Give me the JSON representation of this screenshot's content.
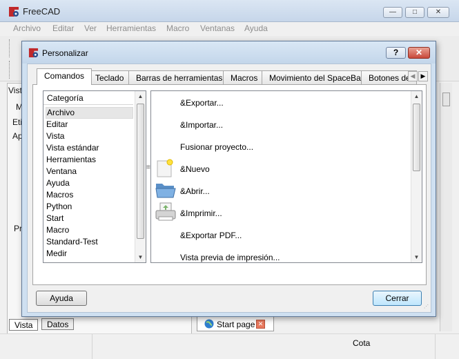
{
  "main_window": {
    "title": "FreeCAD",
    "controls": {
      "minimize": "—",
      "maximize": "□",
      "close": "✕"
    },
    "menu": [
      "Archivo",
      "Editar",
      "Ver",
      "Herramientas",
      "Macro",
      "Ventanas",
      "Ayuda"
    ],
    "left_panel": {
      "top_label": "Vista",
      "tab_label": "M",
      "column_label": "Eti",
      "row_label": "Ap",
      "lower_label": "Pr"
    },
    "bottom_tabs": [
      "Vista",
      "Datos"
    ],
    "start_tab": {
      "label": "Start page",
      "close": "✕"
    },
    "status": {
      "units": "Cota"
    }
  },
  "dialog": {
    "title": "Personalizar",
    "help_button": "?",
    "close_button": "✕",
    "tabs": [
      {
        "label": "Comandos",
        "active": true
      },
      {
        "label": "Teclado"
      },
      {
        "label": "Barras de herramientas"
      },
      {
        "label": "Macros"
      },
      {
        "label": "Movimiento del SpaceBall"
      },
      {
        "label": "Botones de"
      }
    ],
    "tab_scroll": {
      "left": "◀",
      "right": "▶"
    },
    "category_header": "Categoría",
    "categories": [
      "Archivo",
      "Editar",
      "Vista",
      "Vista estándar",
      "Herramientas",
      "Ventana",
      "Ayuda",
      "Macros",
      "Python",
      "Start",
      "Macro",
      "Standard-Test",
      "Medir"
    ],
    "selected_category": "Archivo",
    "commands": [
      {
        "label": "&Exportar...",
        "icon": ""
      },
      {
        "label": "&Importar...",
        "icon": ""
      },
      {
        "label": "Fusionar proyecto...",
        "icon": ""
      },
      {
        "label": "&Nuevo",
        "icon": "new-document-icon"
      },
      {
        "label": "&Abrir...",
        "icon": "open-folder-icon"
      },
      {
        "label": "&Imprimir...",
        "icon": "printer-icon"
      },
      {
        "label": "&Exportar PDF...",
        "icon": ""
      },
      {
        "label": "Vista previa de impresión...",
        "icon": ""
      }
    ],
    "buttons": {
      "help": "Ayuda",
      "close": "Cerrar"
    },
    "scroll_arrows": {
      "up": "▲",
      "down": "▼"
    }
  }
}
